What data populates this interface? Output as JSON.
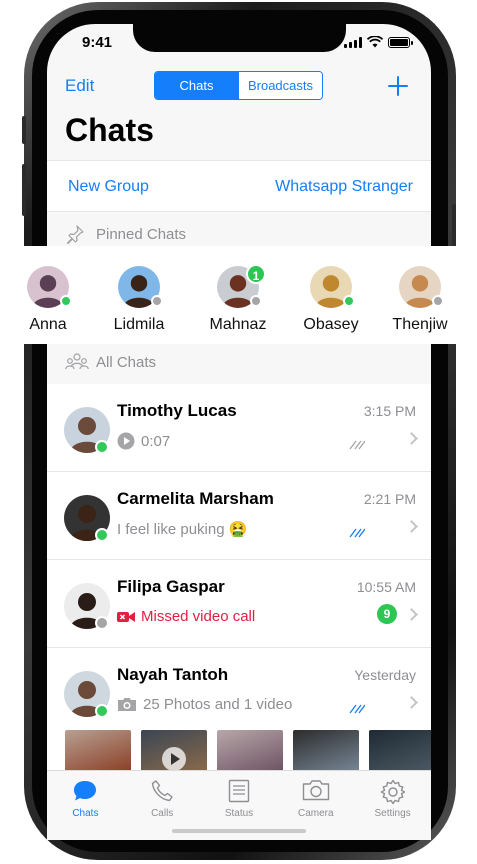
{
  "status_bar": {
    "time": "9:41"
  },
  "header": {
    "edit_label": "Edit",
    "segments": [
      "Chats",
      "Broadcasts"
    ],
    "active_segment": "Chats",
    "title": "Chats"
  },
  "actions": {
    "new_group": "New Group",
    "stranger": "Whatsapp Stranger"
  },
  "sections": {
    "pinned": "Pinned Chats",
    "all": "All Chats"
  },
  "pinned": [
    {
      "name": "Anna",
      "online": true,
      "colors": [
        "#d9c2cf",
        "#5b3f55"
      ]
    },
    {
      "name": "Lidmila",
      "online": false,
      "colors": [
        "#7fb8e8",
        "#3a2418"
      ]
    },
    {
      "name": "Mahnaz",
      "online": false,
      "badge": "1",
      "colors": [
        "#c9cdd2",
        "#6b3222"
      ]
    },
    {
      "name": "Obasey",
      "online": true,
      "colors": [
        "#e9d8b4",
        "#c0882e"
      ]
    },
    {
      "name": "Thenjiw",
      "online": false,
      "colors": [
        "#e6d5c3",
        "#c68a51"
      ]
    }
  ],
  "chats": [
    {
      "name": "Timothy Lucas",
      "time": "3:15 PM",
      "message": "0:07",
      "kind": "voice",
      "online": true,
      "ticks": "read-gray",
      "colors": [
        "#c9d3dd",
        "#6a4a3b"
      ]
    },
    {
      "name": "Carmelita Marsham",
      "time": "2:21 PM",
      "message": "I feel like puking 🤮",
      "kind": "text",
      "online": true,
      "ticks": "read-blue",
      "colors": [
        "#333333",
        "#3b2317"
      ]
    },
    {
      "name": "Filipa Gaspar",
      "time": "10:55 AM",
      "message": "Missed video call",
      "kind": "missed",
      "online": false,
      "unread": "9",
      "colors": [
        "#ececec",
        "#2a1c16"
      ]
    },
    {
      "name": "Nayah Tantoh",
      "time": "Yesterday",
      "message": "25 Photos and 1 video",
      "kind": "photos",
      "online": true,
      "ticks": "read-blue",
      "colors": [
        "#cfd8df",
        "#6b4a3a"
      ]
    }
  ],
  "thumbnails": [
    {
      "colors": [
        "#b7a092",
        "#8a3b22"
      ]
    },
    {
      "colors": [
        "#3b4654",
        "#8c6b4a"
      ],
      "video": true
    },
    {
      "colors": [
        "#b7a7a9",
        "#6a5060"
      ]
    },
    {
      "colors": [
        "#2c2c2c",
        "#7a8a9a"
      ]
    },
    {
      "colors": [
        "#1f2a33",
        "#4e5b66"
      ]
    }
  ],
  "tabs": [
    {
      "label": "Chats",
      "icon": "chat-bubble-icon",
      "active": true
    },
    {
      "label": "Calls",
      "icon": "phone-icon"
    },
    {
      "label": "Status",
      "icon": "status-doc-icon"
    },
    {
      "label": "Camera",
      "icon": "camera-icon"
    },
    {
      "label": "Settings",
      "icon": "gear-icon"
    }
  ],
  "colors": {
    "accent": "#147efb",
    "online": "#34c759",
    "missed": "#e41e3f",
    "badge": "#2dc653"
  }
}
